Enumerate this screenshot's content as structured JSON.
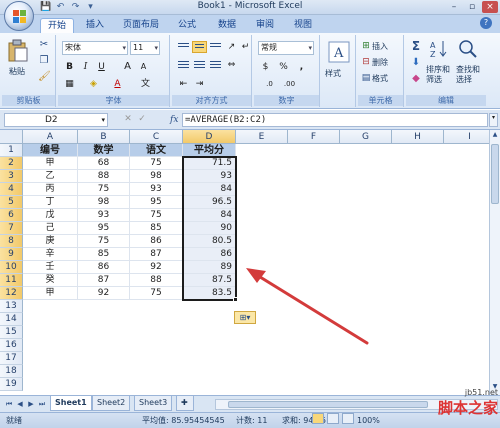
{
  "window": {
    "title": "Book1 - Microsoft Excel",
    "controls": [
      "–",
      "▫",
      "×"
    ]
  },
  "qat": [
    "💾",
    "↶",
    "↷",
    "▾"
  ],
  "tabs": [
    "开始",
    "插入",
    "页面布局",
    "公式",
    "数据",
    "审阅",
    "视图"
  ],
  "ribbon": {
    "clipboard": {
      "label": "剪贴板",
      "paste": "粘贴"
    },
    "font": {
      "label": "字体",
      "name": "宋体",
      "size": "11",
      "bold": "B",
      "italic": "I",
      "underline": "U",
      "grow": "A",
      "shrink": "A",
      "fontcolor": "A"
    },
    "alignment": {
      "label": "对齐方式"
    },
    "number": {
      "label": "数字",
      "format": "常规",
      "currency": "$",
      "percent": "%",
      "comma": ",",
      "inc": ".0",
      "dec": ".00"
    },
    "styles": {
      "label": "样式"
    },
    "cells": {
      "label": "单元格",
      "insert": "插入",
      "delete": "删除",
      "format": "格式"
    },
    "editing": {
      "label": "编辑",
      "sort": "排序和\n筛选",
      "find": "查找和\n选择",
      "sum": "Σ"
    }
  },
  "formula_bar": {
    "name_box": "D2",
    "fx": "fx",
    "formula": "=AVERAGE(B2:C2)"
  },
  "columns": [
    "A",
    "B",
    "C",
    "D",
    "E",
    "F",
    "G",
    "H",
    "I"
  ],
  "rows": [
    "1",
    "2",
    "3",
    "4",
    "5",
    "6",
    "7",
    "8",
    "9",
    "10",
    "11",
    "12",
    "13",
    "14",
    "15",
    "16",
    "17",
    "18",
    "19"
  ],
  "table": {
    "headers": [
      "编号",
      "数学",
      "语文",
      "平均分"
    ],
    "data": [
      [
        "甲",
        "68",
        "75",
        "71.5"
      ],
      [
        "乙",
        "88",
        "98",
        "93"
      ],
      [
        "丙",
        "75",
        "93",
        "84"
      ],
      [
        "丁",
        "98",
        "95",
        "96.5"
      ],
      [
        "戊",
        "93",
        "75",
        "84"
      ],
      [
        "己",
        "95",
        "85",
        "90"
      ],
      [
        "庚",
        "75",
        "86",
        "80.5"
      ],
      [
        "辛",
        "85",
        "87",
        "86"
      ],
      [
        "壬",
        "86",
        "92",
        "89"
      ],
      [
        "癸",
        "87",
        "88",
        "87.5"
      ],
      [
        "甲",
        "92",
        "75",
        "83.5"
      ]
    ]
  },
  "sheets": [
    "Sheet1",
    "Sheet2",
    "Sheet3"
  ],
  "status": {
    "ready": "就绪",
    "average": "平均值: 85.95454545",
    "count": "计数: 11",
    "sum": "求和: 945.5",
    "zoom": "100%"
  },
  "watermark": {
    "url": "jb51.net",
    "brand": "脚本之家"
  },
  "colors": {
    "accent": "#d33b3b",
    "header_fill": "#b7cde9",
    "ribbon": "#dce8f7"
  }
}
